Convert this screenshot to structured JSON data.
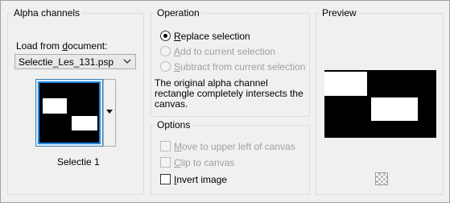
{
  "alpha_channels": {
    "title": "Alpha channels",
    "load_label_prefix": "Load from ",
    "load_label_underlined": "d",
    "load_label_suffix": "ocument:",
    "document_value": "Selectie_Les_131.psp",
    "thumbnail_caption": "Selectie 1"
  },
  "operation": {
    "title": "Operation",
    "options": [
      {
        "underline": "R",
        "rest": "eplace selection",
        "selected": true,
        "enabled": true
      },
      {
        "underline": "A",
        "rest": "dd to current selection",
        "selected": false,
        "enabled": false
      },
      {
        "underline": "S",
        "rest": "ubtract from current selection",
        "selected": false,
        "enabled": false
      }
    ],
    "description": "The original alpha channel rectangle completely intersects the canvas."
  },
  "options": {
    "title": "Options",
    "items": [
      {
        "underline": "M",
        "rest": "ove to upper left of canvas",
        "checked": false,
        "enabled": false
      },
      {
        "underline": "C",
        "rest": "lip to canvas",
        "checked": false,
        "enabled": false
      },
      {
        "underline": "I",
        "rest": "nvert image",
        "checked": false,
        "enabled": true
      }
    ]
  },
  "preview": {
    "title": "Preview"
  }
}
